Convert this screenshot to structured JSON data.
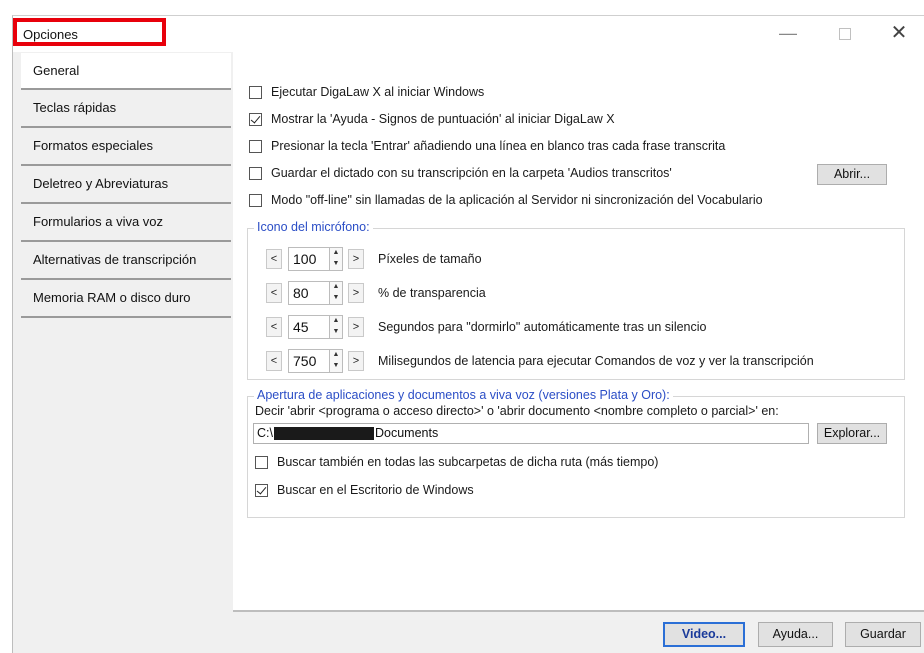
{
  "window": {
    "title": "Opciones"
  },
  "sidebar": {
    "items": [
      {
        "label": "General"
      },
      {
        "label": "Teclas rápidas"
      },
      {
        "label": "Formatos especiales"
      },
      {
        "label": "Deletreo y Abreviaturas"
      },
      {
        "label": "Formularios a viva voz"
      },
      {
        "label": "Alternativas de transcripción"
      },
      {
        "label": "Memoria RAM o disco duro"
      }
    ]
  },
  "general": {
    "options": [
      {
        "label": "Ejecutar DigaLaw X al iniciar Windows",
        "checked": false
      },
      {
        "label": "Mostrar la 'Ayuda - Signos de puntuación' al iniciar DigaLaw X",
        "checked": true
      },
      {
        "label": "Presionar la tecla 'Entrar' añadiendo una línea en blanco tras cada frase transcrita",
        "checked": false
      },
      {
        "label": "Guardar el dictado con su transcripción en la carpeta 'Audios transcritos'",
        "checked": false
      },
      {
        "label": "Modo \"off-line\" sin llamadas de la aplicación al Servidor ni sincronización del Vocabulario",
        "checked": false
      }
    ],
    "open_button": "Abrir..."
  },
  "mic": {
    "title": "Icono del micrófono:",
    "prev_symbol": "<",
    "next_symbol": ">",
    "up_symbol": "▲",
    "down_symbol": "▼",
    "settings": [
      {
        "value": "100",
        "label": "Píxeles de tamaño"
      },
      {
        "value": "80",
        "label": "% de transparencia"
      },
      {
        "value": "45",
        "label": "Segundos para \"dormirlo\" automáticamente tras un silencio"
      },
      {
        "value": "750",
        "label": "Milisegundos de latencia para ejecutar Comandos de voz y ver la transcripción"
      }
    ]
  },
  "apps": {
    "title": "Apertura de aplicaciones y documentos a viva voz (versiones Plata y Oro):",
    "instruction": "Decir 'abrir <programa o acceso directo>' o 'abrir documento <nombre completo o parcial>' en:",
    "path_prefix": "C:\\",
    "path_suffix": "Documents",
    "explore_button": "Explorar...",
    "options": [
      {
        "label": "Buscar también en todas las subcarpetas de dicha ruta (más tiempo)",
        "checked": false
      },
      {
        "label": "Buscar en el Escritorio de Windows",
        "checked": true
      }
    ]
  },
  "footer": {
    "video_button": "Video...",
    "help_button": "Ayuda...",
    "save_button": "Guardar"
  },
  "colors": {
    "highlight_box": "#e8000b",
    "group_title": "#2b4ec6"
  }
}
